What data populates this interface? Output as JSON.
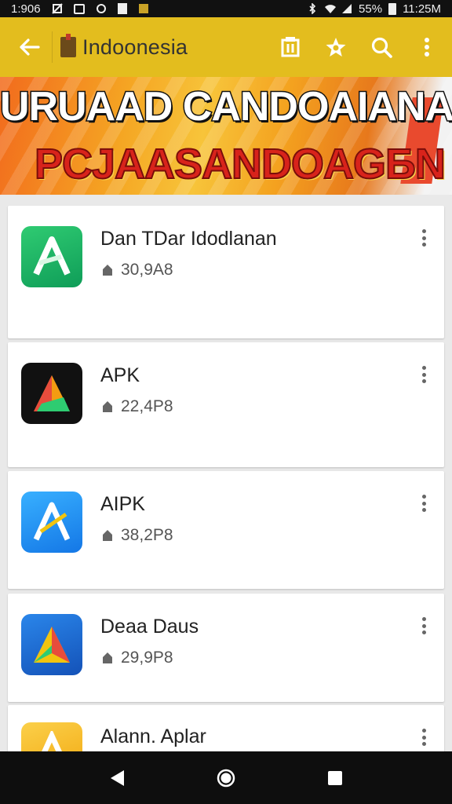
{
  "status_bar": {
    "time_left": "1:906",
    "battery": "55%",
    "time_right": "11:25M"
  },
  "app_bar": {
    "title": "Indoonesia"
  },
  "banner": {
    "line1": "URUAAD CANDOAIANAN",
    "line2": "PCJAASANDOAGБN"
  },
  "apps": [
    {
      "name": "Dan TDar Idodlanan",
      "downloads": "30,9A8",
      "icon_colors": [
        "#28c469",
        "#0f9d58"
      ]
    },
    {
      "name": "APK",
      "downloads": "22,4P8",
      "icon_colors": [
        "#111111",
        "#000000"
      ]
    },
    {
      "name": "AIPK",
      "downloads": "38,2P8",
      "icon_colors": [
        "#2ea6ff",
        "#1477e6"
      ]
    },
    {
      "name": "Deaa Daus",
      "downloads": "29,9P8",
      "icon_colors": [
        "#1f7ae0",
        "#1452b8"
      ]
    },
    {
      "name": "Alann. Aplar",
      "downloads": "",
      "icon_colors": [
        "#f9c321",
        "#f2a50c"
      ]
    }
  ]
}
